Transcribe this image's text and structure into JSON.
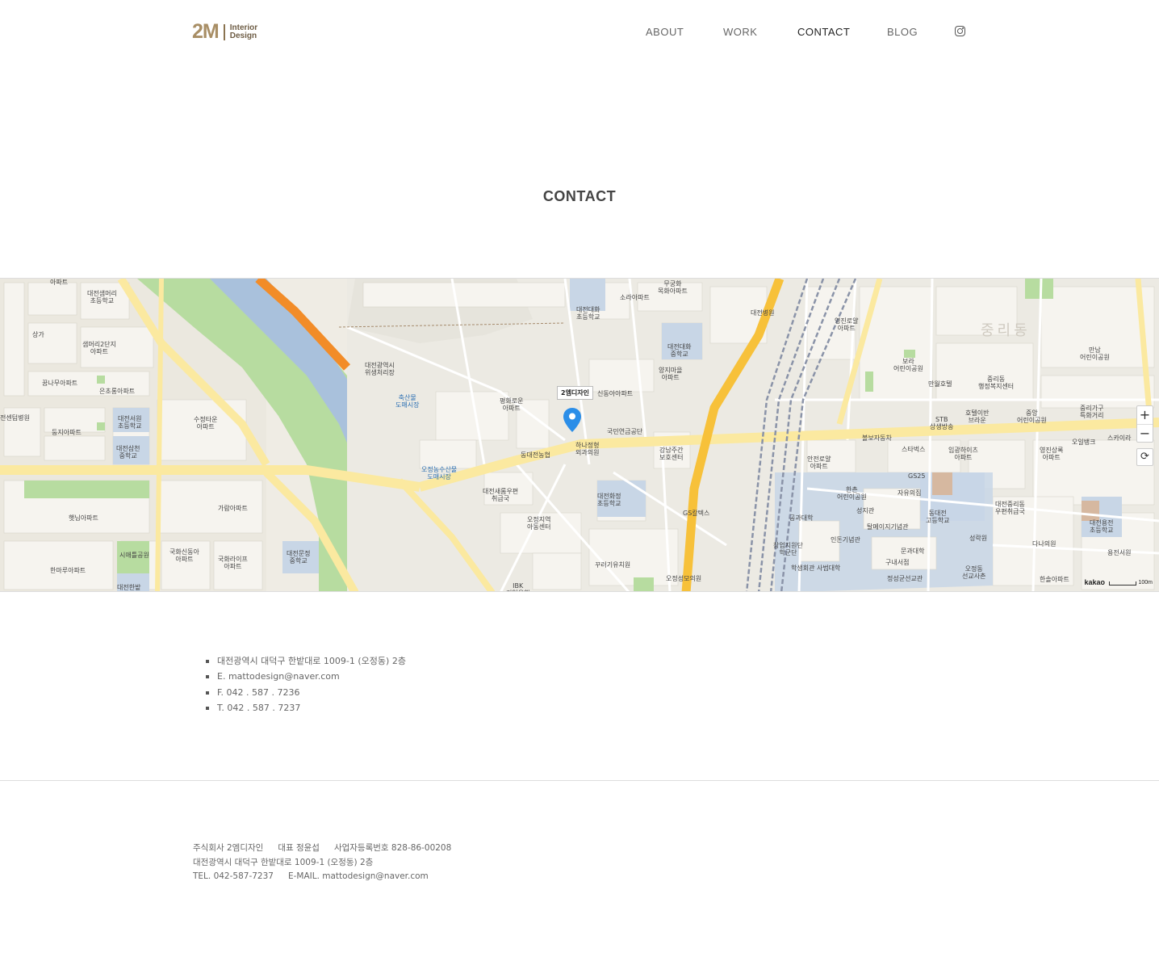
{
  "header": {
    "logo": {
      "mark": "2M",
      "line1": "Interior",
      "line2": "Design"
    },
    "nav": [
      "ABOUT",
      "WORK",
      "CONTACT",
      "BLOG"
    ],
    "active_nav": "CONTACT",
    "instagram_icon": "instagram-icon"
  },
  "page": {
    "title": "CONTACT"
  },
  "map": {
    "marker_label": "2엠디자인",
    "attribution": "kakao",
    "scale": "100m",
    "zoom_in": "+",
    "zoom_out": "−",
    "reset": "⟳",
    "labels": [
      "아파트",
      "대전샘머리\n초등학교",
      "상가",
      "샘머리2단지\n아파트",
      "꿈나무아파트",
      "은초롱아파트",
      "대전서원\n초등학교",
      "수정타운\n아파트",
      "둥지아파트",
      "대전삼천\n중학교",
      "전센텀병원",
      "햇님아파트",
      "가람아파트",
      "시애틀공원",
      "국화신동아\n아파트",
      "국화라이프\n아파트",
      "대전문정\n중학교",
      "한마루아파트",
      "대전한밭",
      "대전광역시\n위생처리장",
      "축산물\n도매시장",
      "오정농수산물\n도매시장",
      "대전대화\n초등학교",
      "무궁화\n목화아파트",
      "소라아파트",
      "대전대화\n중학교",
      "양지마을\n아파트",
      "평화로운\n아파트",
      "신동아아파트",
      "국민연금공단",
      "하나정형\n외과의원",
      "동대전농협",
      "강남주간\n보호센터",
      "대전새롬우편\n취급국",
      "대전화정\n초등학교",
      "오정지역\n아동센터",
      "GS칼텍스",
      "꾸러기유치원",
      "오정성모의원",
      "IBK\n기업은행",
      "대전병원",
      "영진로얄\n아파트",
      "중리동",
      "보라\n어린이공원",
      "만월호텔",
      "중리동\n행정복지센터",
      "호텔이반\n브라운",
      "STB\n상생방송",
      "중앙\n어린이공원",
      "중리가구\n특화거리",
      "만남\n어린이공원",
      "볼보자동차",
      "스타벅스",
      "임광하이츠\n아파트",
      "오일뱅크",
      "스카이라",
      "안전로얄\n아파트",
      "GS25",
      "한촌\n어린이공원",
      "자유의집",
      "대전중리동\n우편취급국",
      "영진상록\n아파트",
      "공과대학",
      "성지관",
      "탈메이지기념관",
      "동대전\n고등학교",
      "인돈기념관",
      "창업지원단\n학군단",
      "문과대학",
      "성락원",
      "다나의원",
      "대전용전\n초등학교",
      "용전서원",
      "학생회관 사범대학",
      "구내서점",
      "정성균선교관",
      "오정동\n선교사촌",
      "한솔아파트"
    ]
  },
  "contact": {
    "items": [
      "대전광역시 대덕구 한밭대로 1009-1 (오정동) 2층",
      "E. mattodesign@naver.com",
      "F. 042 . 587 . 7236",
      "T. 042 . 587 . 7237"
    ]
  },
  "footer": {
    "company": "주식회사 2엠디자인",
    "ceo": "대표 정윤섭",
    "biz_no": "사업자등록번호 828-86-00208",
    "address": "대전광역시 대덕구 한밭대로 1009-1 (오정동) 2층",
    "tel": "TEL. 042-587-7237",
    "email": "E-MAIL. mattodesign@naver.com"
  },
  "colors": {
    "brand": "#a88e65",
    "river": "#a9c1dc",
    "park": "#b7dca0",
    "major_road": "#fbe9a0",
    "highway": "#f7c13a",
    "orange_road": "#f28c28",
    "marker": "#2b8ee8"
  }
}
